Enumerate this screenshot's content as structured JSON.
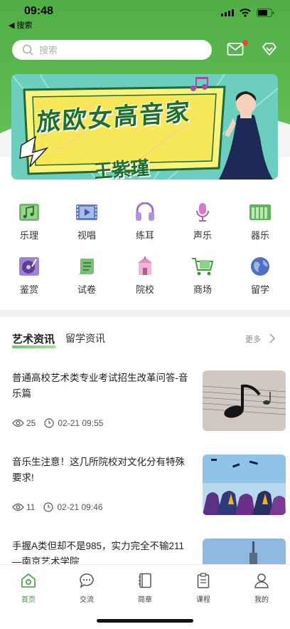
{
  "status_bar": {
    "time": "09:48",
    "back_label": "◀ 搜索"
  },
  "header": {
    "search_placeholder": "搜索",
    "mail_icon": "mail-icon",
    "gem_icon": "diamond-icon"
  },
  "banner": {
    "title": "旅欧女高音家",
    "name": "王紫瑾"
  },
  "categories": [
    {
      "label": "乐理",
      "icon": "music-theory-icon"
    },
    {
      "label": "视唱",
      "icon": "film-icon"
    },
    {
      "label": "练耳",
      "icon": "headphones-icon"
    },
    {
      "label": "声乐",
      "icon": "microphone-icon"
    },
    {
      "label": "器乐",
      "icon": "piano-keys-icon"
    },
    {
      "label": "鉴赏",
      "icon": "record-player-icon"
    },
    {
      "label": "试卷",
      "icon": "scroll-icon"
    },
    {
      "label": "院校",
      "icon": "school-icon"
    },
    {
      "label": "商场",
      "icon": "cart-icon"
    },
    {
      "label": "留学",
      "icon": "globe-icon"
    }
  ],
  "news": {
    "tabs": [
      {
        "label": "艺术资讯"
      },
      {
        "label": "留学资讯"
      }
    ],
    "more_label": "更多",
    "articles": [
      {
        "title": "普通高校艺术类专业考试招生改革问答-音乐篇",
        "views": "25",
        "time": "02-21 09:55",
        "thumb": "sheet-music-photo"
      },
      {
        "title": "音乐生注意！这几所院校对文化分有特殊要求!",
        "views": "11",
        "time": "02-21 09:46",
        "thumb": "graduates-photo"
      },
      {
        "title": "手握A类但却不是985，实力完全不输211—南京艺术学院",
        "views": "",
        "time": "",
        "thumb": "tower-photo"
      }
    ]
  },
  "tab_bar": [
    {
      "label": "首页",
      "icon": "home-icon",
      "active": true
    },
    {
      "label": "交流",
      "icon": "chat-icon",
      "active": false
    },
    {
      "label": "简章",
      "icon": "book-icon",
      "active": false
    },
    {
      "label": "课程",
      "icon": "clipboard-icon",
      "active": false
    },
    {
      "label": "我的",
      "icon": "user-icon",
      "active": false
    }
  ],
  "colors": {
    "brand_green": "#4fae45",
    "active_tab": "#3f9a3b",
    "badge_red": "#e9433a"
  }
}
